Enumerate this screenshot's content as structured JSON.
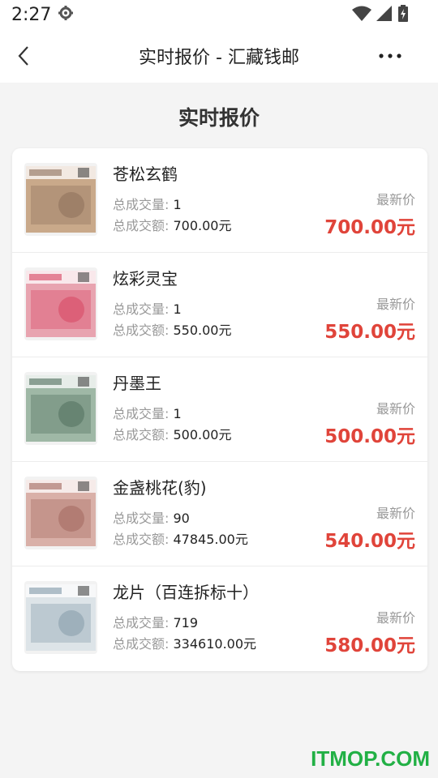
{
  "status": {
    "time": "2:27"
  },
  "nav": {
    "title": "实时报价 - 汇藏钱邮"
  },
  "page": {
    "heading": "实时报价"
  },
  "labels": {
    "qty": "总成交量:",
    "amount": "总成交额:",
    "latest": "最新价"
  },
  "items": [
    {
      "name": "苍松玄鹤",
      "qty": "1",
      "amount": "700.00元",
      "price": "700.00元",
      "thumb_bg": "#c9a98a",
      "thumb_accent": "#8a6c58"
    },
    {
      "name": "炫彩灵宝",
      "qty": "1",
      "amount": "550.00元",
      "price": "550.00元",
      "thumb_bg": "#e8a4b0",
      "thumb_accent": "#d6405e"
    },
    {
      "name": "丹墨王",
      "qty": "1",
      "amount": "500.00元",
      "price": "500.00元",
      "thumb_bg": "#9fb8a6",
      "thumb_accent": "#4c6b5a"
    },
    {
      "name": "金盏桃花(豹)",
      "qty": "90",
      "amount": "47845.00元",
      "price": "540.00元",
      "thumb_bg": "#d9b0a8",
      "thumb_accent": "#a0645a"
    },
    {
      "name": "龙片（百连拆标十）",
      "qty": "719",
      "amount": "334610.00元",
      "price": "580.00元",
      "thumb_bg": "#dde4e8",
      "thumb_accent": "#7f97a6"
    }
  ],
  "watermark": "ITMOP.COM",
  "colors": {
    "price_red": "#e0443a",
    "watermark_green": "#22b045"
  }
}
